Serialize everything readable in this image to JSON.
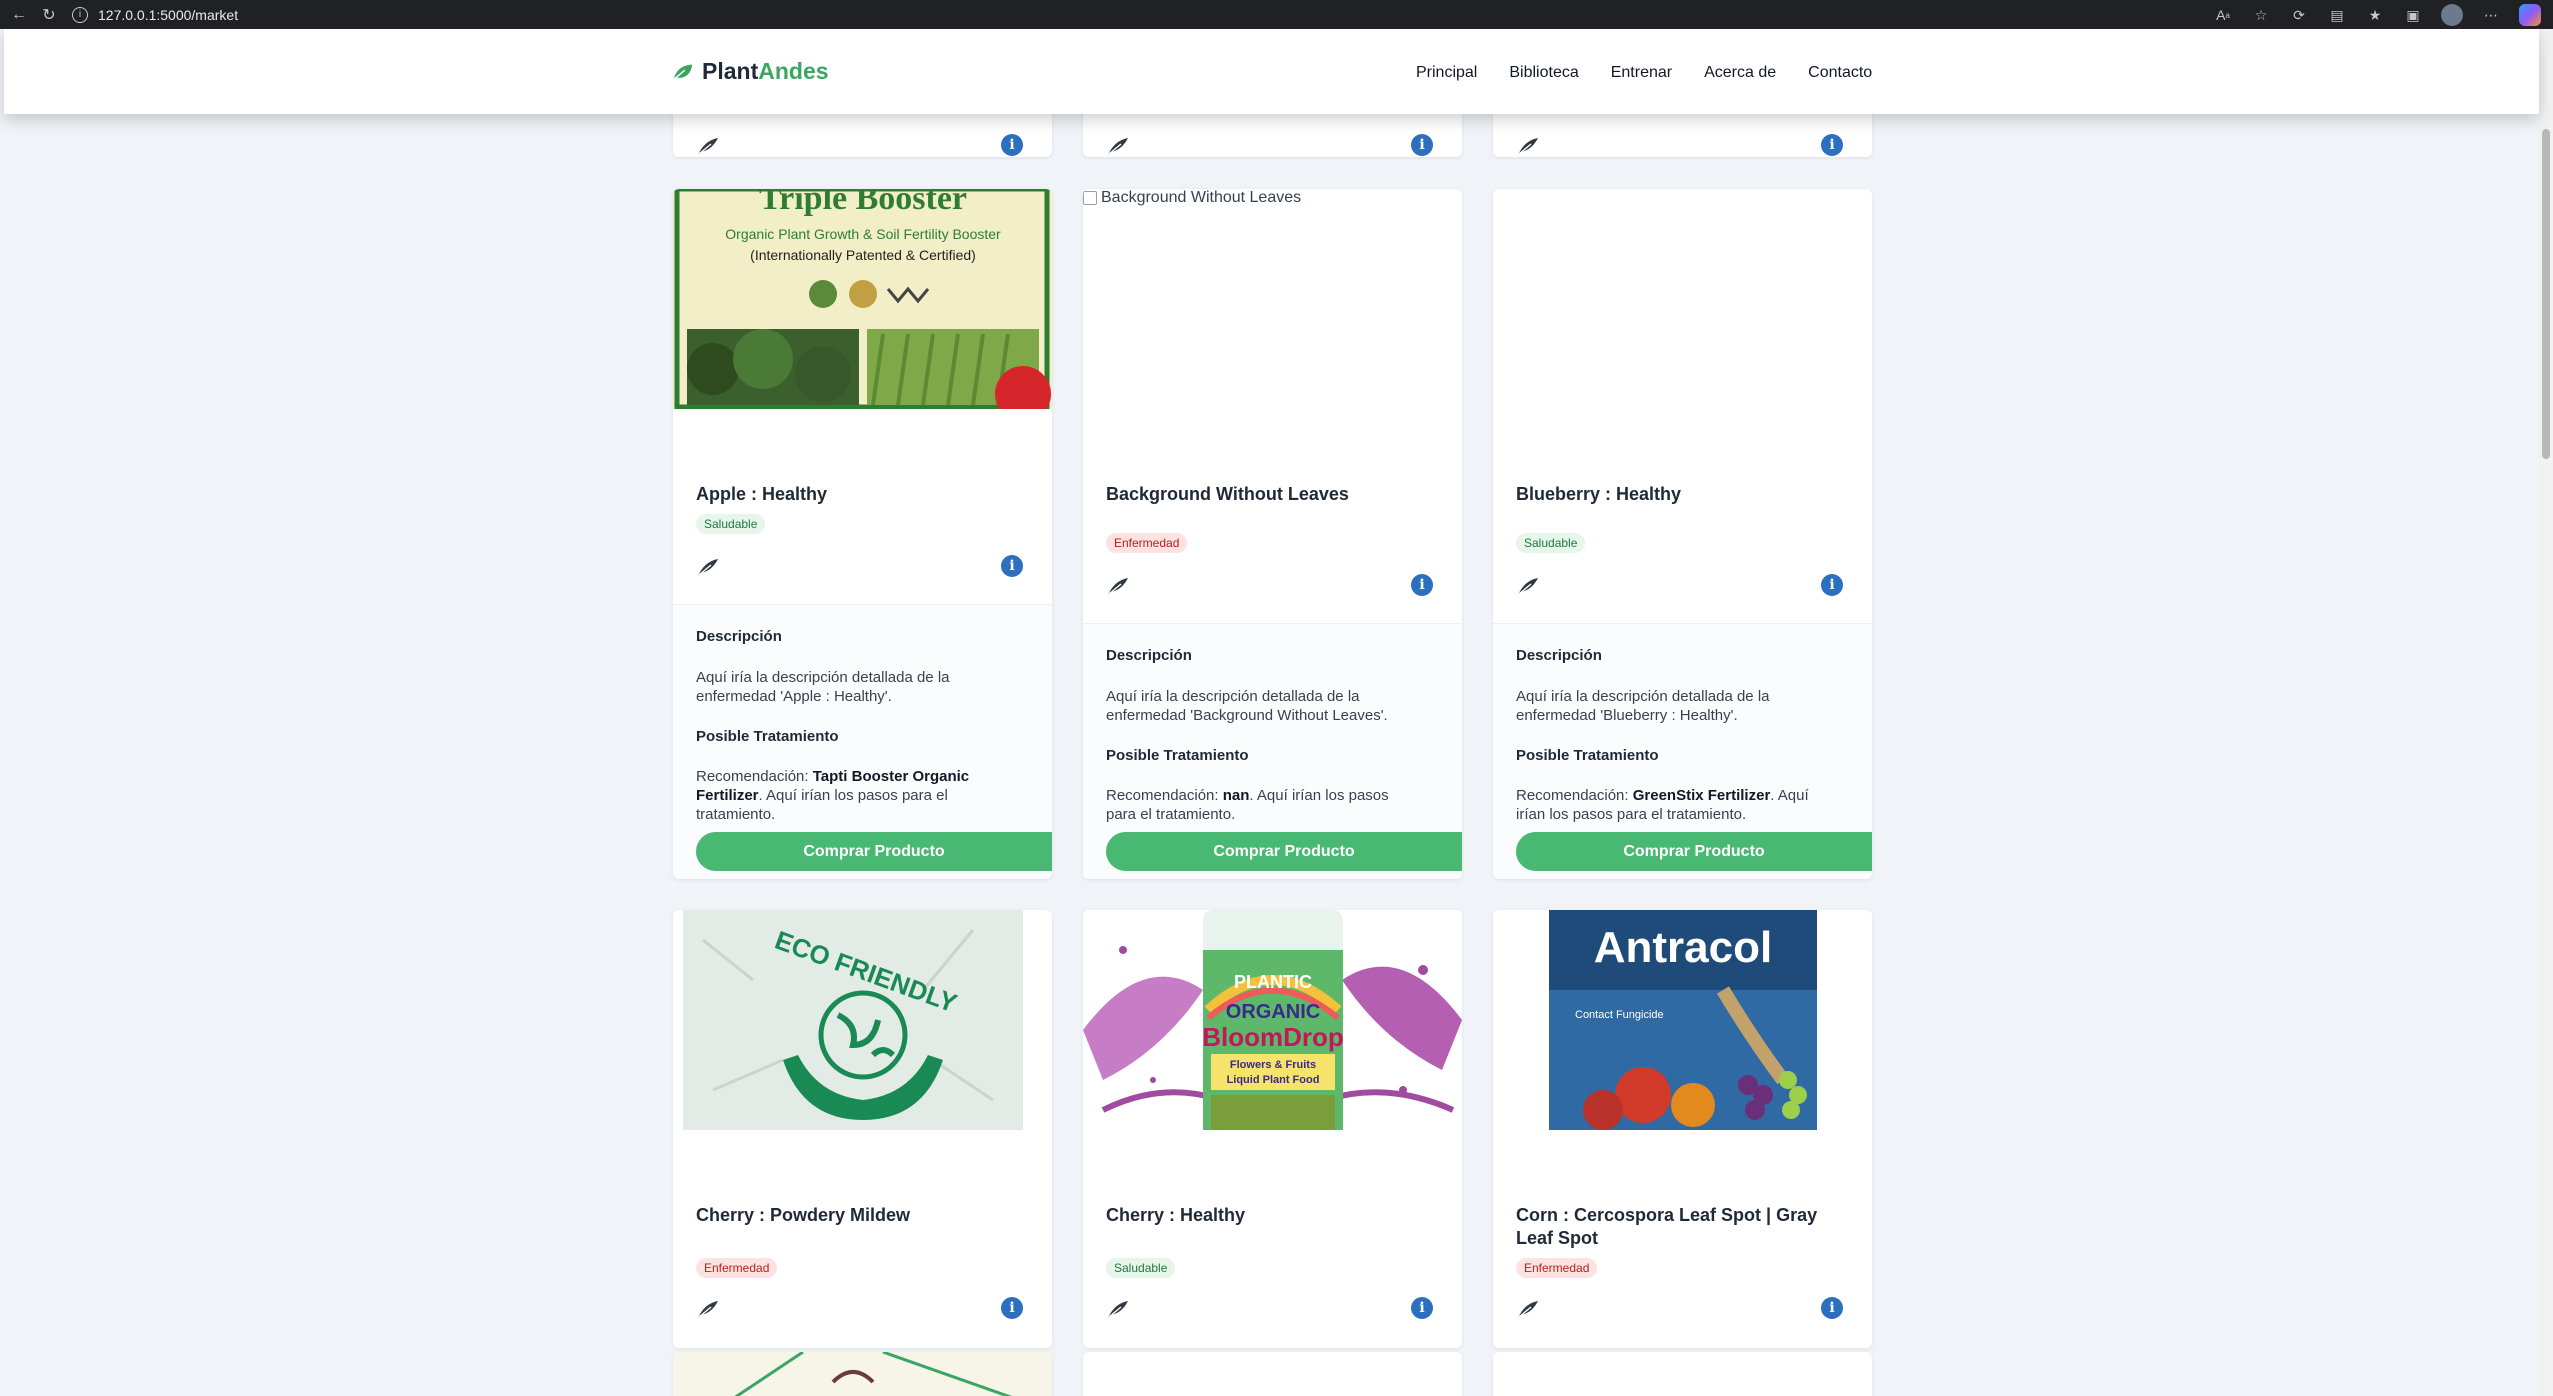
{
  "browser": {
    "url": "127.0.0.1:5000/market"
  },
  "site": {
    "logo_plant": "Plant",
    "logo_andes": "Andes",
    "nav": [
      "Principal",
      "Biblioteca",
      "Entrenar",
      "Acerca de",
      "Contacto"
    ]
  },
  "labels": {
    "description": "Descripción",
    "treatment": "Posible Tratamiento",
    "recommendation_prefix": "Recomendación: ",
    "buy": "Comprar Producto",
    "steps_suffix": ". Aquí irían los pasos para el tratamiento."
  },
  "cards": [
    {
      "title": "Apple : Healthy",
      "status": "Saludable",
      "image": "Triple Booster organic fertilizer package",
      "image_text": [
        "Triple Booster",
        "Organic Plant Growth & Soil Fertility Booster",
        "(Internationally Patented & Certified)"
      ],
      "description": "Aquí iría la descripción detallada de la enfermedad 'Apple : Healthy'.",
      "product": "Tapti Booster Organic Fertilizer"
    },
    {
      "title": "Background Without Leaves",
      "status": "Enfermedad",
      "image_alt": "Background Without Leaves",
      "description": "Aquí iría la descripción detallada de la enfermedad 'Background Without Leaves'.",
      "product": "nan"
    },
    {
      "title": "Blueberry : Healthy",
      "status": "Saludable",
      "description": "Aquí iría la descripción detallada de la enfermedad 'Blueberry : Healthy'.",
      "product": "GreenStix Fertilizer"
    },
    {
      "title": "Cherry : Powdery Mildew",
      "status": "Enfermedad",
      "image_text": [
        "ECO FRIENDLY"
      ]
    },
    {
      "title": "Cherry : Healthy",
      "status": "Saludable",
      "image_text": [
        "PLANTIC",
        "ORGANIC",
        "BloomDrop",
        "Flowers & Fruits",
        "Liquid Plant Food"
      ]
    },
    {
      "title": "Corn : Cercospora Leaf Spot | Gray Leaf Spot",
      "title_line1": "Corn : Cercospora Leaf Spot | Gray",
      "title_line2": "Leaf Spot",
      "status": "Enfermedad",
      "image_text": [
        "Antracol",
        "Contact Fungicide"
      ]
    }
  ]
}
